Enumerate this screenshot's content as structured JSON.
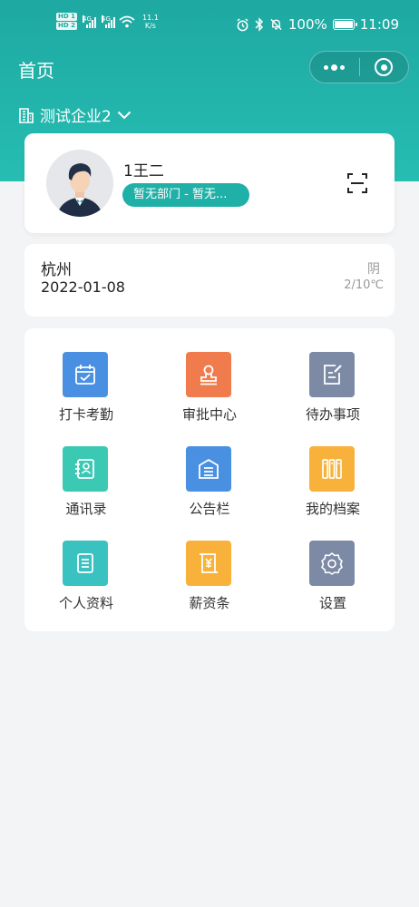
{
  "status_bar": {
    "hd1": "HD 1",
    "hd2": "HD 2",
    "net1": "4G",
    "net2": "4G",
    "speed_value": "11.1",
    "speed_unit": "K/s",
    "battery": "100%",
    "time": "11:09",
    "icons": [
      "alarm-icon",
      "bluetooth-icon",
      "mute-icon",
      "battery-icon"
    ]
  },
  "nav": {
    "title": "首页",
    "capsule_icons": [
      "more-dots-icon",
      "close-target-icon"
    ]
  },
  "company": {
    "name": "测试企业2",
    "icon": "building-icon"
  },
  "profile": {
    "name": "1王二",
    "dept": "暂无部门 - 暂无...",
    "scan_icon": "scan-icon"
  },
  "weather": {
    "city": "杭州",
    "date": "2022-01-08",
    "condition": "阴",
    "temp": "2/10℃"
  },
  "menu": [
    {
      "label": "打卡考勤",
      "icon": "calendar-check-icon",
      "color": "#4a90e2"
    },
    {
      "label": "审批中心",
      "icon": "stamp-icon",
      "color": "#f07b4c"
    },
    {
      "label": "待办事项",
      "icon": "edit-note-icon",
      "color": "#7c8aa6"
    },
    {
      "label": "通讯录",
      "icon": "contact-book-icon",
      "color": "#3cc9b4"
    },
    {
      "label": "公告栏",
      "icon": "notice-board-icon",
      "color": "#4a90e2"
    },
    {
      "label": "我的档案",
      "icon": "files-icon",
      "color": "#f8b23c"
    },
    {
      "label": "个人资料",
      "icon": "document-icon",
      "color": "#39c2c0"
    },
    {
      "label": "薪资条",
      "icon": "salary-icon",
      "color": "#f8b23c"
    },
    {
      "label": "设置",
      "icon": "settings-gear-icon",
      "color": "#7c8aa6"
    }
  ]
}
